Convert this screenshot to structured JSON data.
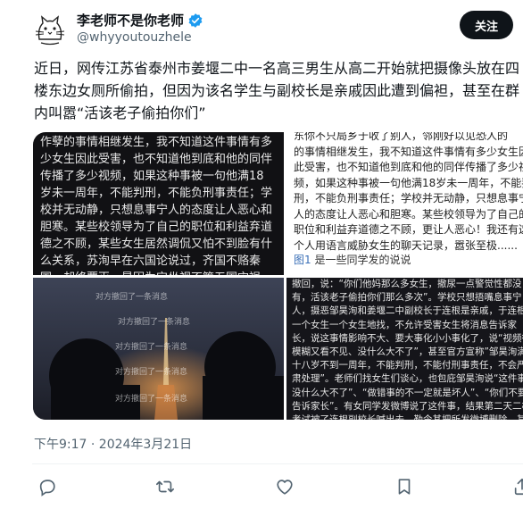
{
  "author": {
    "display_name": "李老师不是你老师",
    "handle": "@whyyoutouzhele",
    "avatar_icon": "cat-sketch-avatar",
    "verified_icon": "verified-badge-icon",
    "verified_color": "#1d9bf0"
  },
  "follow_label": "关注",
  "tweet_text": "近日，网传江苏省泰州市姜堰二中一名高三男生从高二开始就把摄像头放在四楼东边女厕所偷拍，但因为该名学生与副校长是亲戚因此遭到偏袒，甚至在群内叫嚣“活该老子偷拍你们”",
  "media": {
    "panel1_text": "作孽的事情相继发生，我不知道这件事情有多少女生因此受害，也不知道他到底和他的同伴传播了多少视频，如果这种事被一句他满18岁未一周年，不能判刑，不能负刑事责任；学校并无动静，只想息事宁人的态度让人恶心和胆寒。某些校领导为了自己的职位和利益弃道德之不顾，某些女生居然调侃又怕不到脸有什么关系，苏洵早在六国论说过，齐国不赂秦国，却终覆灭，是因为它坐视不管五国灾祸，唇亡齿寒，不仅仅是",
    "panel2_text": "东你不只局乡于收了别人，邻刚好以见恐人的\n的事情相继发生，我不知道这件事情有多少女生因\n此受害，也不知道他到底和他的同伴传播了多少视\n频，如果这种事被一句他满18岁未一周年，不能判\n刑，不能负刑事责任；学校并无动静，只想息事宁\n人的态度让人恶心和胆寒。某些校领导为了自己的\n职位和利益弃道德之不顾，更让人恶心！我还有这\n个人用语言威胁女生的聊天记录，嚣张至极......",
    "panel2_caption_fig": "图1",
    "panel2_caption_text": " 是一些同学发的说说",
    "panel3_withdrawn_label": "对方撤回了一条消息",
    "panel4_text": "撤回，说：“你们他妈那么多女生，撤尿一点警觉性都没有，活该老子偷拍你们那么多次”。学校只想捂嘴息事宁人，摄恶邹昊洵和姜堰二中副校长于连根是亲戚，于连根一个女生一个女生地找，不允许受害女生将消息告诉家长，说这事情影响不大、要大事化小小事化了，说“视频很模糊又看不见、没什么大不了”，甚至官方宣称”邹昊洵满十八岁不到一周年，不能判刑，不能付刑事责任，不会严肃处理”。老师们找女生们谈心，也包庇邹昊洵说“这件事没什么大不了”、“做错事的不一定就是坏人”、“你们不要告诉家长”。有女同学发微博说了这件事，结果第二天二模考试被了连根副校长喊出去，勒令其把所发微博删除，其他发表的微博和B站视"
  },
  "timestamp": "下午9:17 · 2024年3月21日",
  "actions": [
    {
      "name": "reply-icon",
      "color": "#536471"
    },
    {
      "name": "repost-icon",
      "color": "#536471"
    },
    {
      "name": "like-icon",
      "color": "#536471"
    },
    {
      "name": "bookmark-icon",
      "color": "#536471"
    },
    {
      "name": "share-icon",
      "color": "#536471"
    }
  ]
}
